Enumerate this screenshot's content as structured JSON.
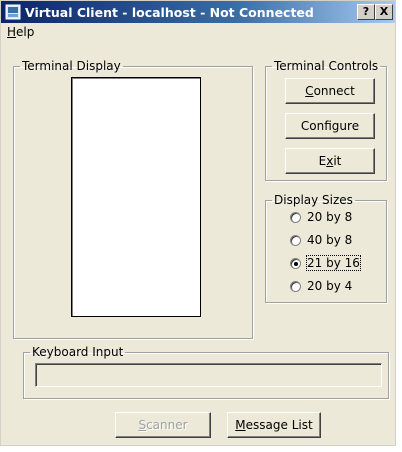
{
  "window": {
    "title": "Virtual Client - localhost - Not Connected",
    "help_btn": "?",
    "close_btn": "X"
  },
  "menu": {
    "help": "Help"
  },
  "terminal_display": {
    "legend": "Terminal Display"
  },
  "terminal_controls": {
    "legend": "Terminal Controls",
    "connect": "Connect",
    "configure": "Configure",
    "exit": "Exit"
  },
  "display_sizes": {
    "legend": "Display Sizes",
    "options": [
      {
        "label": "20 by 8",
        "checked": false
      },
      {
        "label": "40 by 8",
        "checked": false
      },
      {
        "label": "21 by 16",
        "checked": true
      },
      {
        "label": "20 by 4",
        "checked": false
      }
    ]
  },
  "keyboard_input": {
    "legend": "Keyboard Input",
    "value": ""
  },
  "footer": {
    "scanner": "Scanner",
    "message_list": "Message List"
  },
  "colors": {
    "titlebar_start": "#0a246a",
    "titlebar_end": "#a6caf0",
    "face": "#ece9d8"
  }
}
